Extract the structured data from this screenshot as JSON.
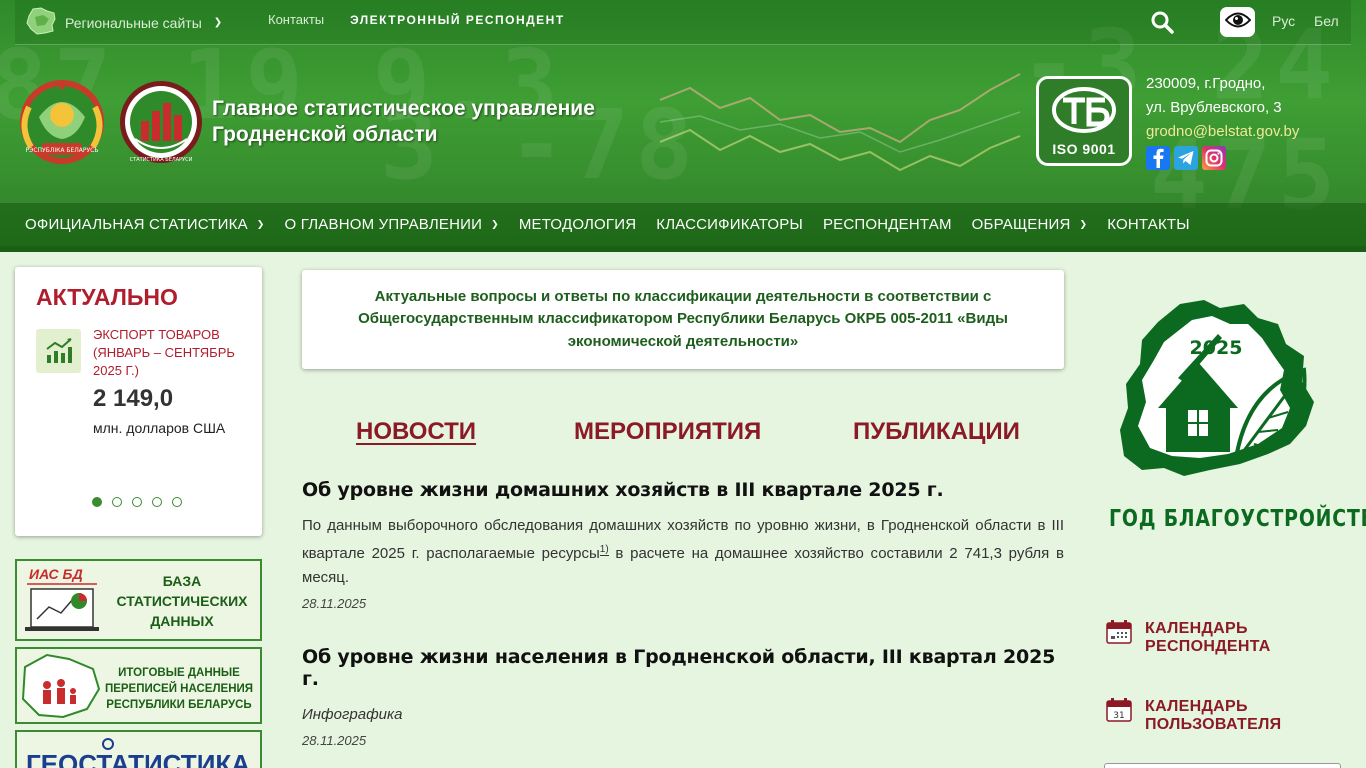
{
  "topbar": {
    "regional_label": "Региональные сайты",
    "contacts_link": "Контакты",
    "e_respondent_link": "ЭЛЕКТРОННЫЙ РЕСПОНДЕНТ",
    "lang_ru": "Рус",
    "lang_be": "Бел"
  },
  "header": {
    "title_line1": "Главное статистическое управление",
    "title_line2": "Гродненской области",
    "iso_label": "ISO 9001",
    "address_line1": "230009, г.Гродно,",
    "address_line2": "ул. Врублевского, 3",
    "email": "grodno@belstat.gov.by",
    "emblem_text_1": "РЭСПУБЛІКА БЕЛАРУСЬ",
    "emblem_text_2": "СТАТИСТИКА БЕЛАРУСИ"
  },
  "nav": {
    "items": [
      {
        "label": "ОФИЦИАЛЬНАЯ СТАТИСТИКА",
        "dropdown": true
      },
      {
        "label": "О ГЛАВНОМ УПРАВЛЕНИИ",
        "dropdown": true
      },
      {
        "label": "МЕТОДОЛОГИЯ",
        "dropdown": false
      },
      {
        "label": "КЛАССИФИКАТОРЫ",
        "dropdown": false
      },
      {
        "label": "РЕСПОНДЕНТАМ",
        "dropdown": false
      },
      {
        "label": "ОБРАЩЕНИЯ",
        "dropdown": true
      },
      {
        "label": "КОНТАКТЫ",
        "dropdown": false
      }
    ]
  },
  "aktual": {
    "heading": "АКТУАЛЬНО",
    "label": "ЭКСПОРТ ТОВАРОВ (ЯНВАРЬ – СЕНТЯБРЬ 2025 Г.)",
    "value": "2 149,0",
    "unit": "млн. долларов США",
    "slides": 5,
    "active_slide": 1
  },
  "banners": {
    "b1_tag": "ИАС БД",
    "b1_line1": "БАЗА",
    "b1_line2": "СТАТИСТИЧЕСКИХ",
    "b1_line3": "ДАННЫХ",
    "b2_line1": "ИТОГОВЫЕ ДАННЫЕ",
    "b2_line2": "ПЕРЕПИСЕЙ НАСЕЛЕНИЯ",
    "b2_line3": "РЕСПУБЛИКИ БЕЛАРУСЬ",
    "b3_text": "ГЕОСТАТИСТИКА"
  },
  "notice": {
    "text": "Актуальные вопросы и ответы по классификации деятельности в соответствии с Общегосударственным классификатором Республики Беларусь ОКРБ 005-2011 «Виды экономической деятельности»"
  },
  "tabs": {
    "news": "НОВОСТИ",
    "events": "МЕРОПРИЯТИЯ",
    "publications": "ПУБЛИКАЦИИ"
  },
  "news": [
    {
      "title": "Об уровне жизни домашних хозяйств в III квартале 2025 г.",
      "desc_before": "По данным выборочного обследования домашних хозяйств по уровню жизни, в Гродненской области в III квартале 2025 г. располагаемые ресурсы",
      "footnote": "1)",
      "desc_after": " в расчете на домашнее хозяйство составили 2 741,3 рубля в месяц.",
      "date": "28.11.2025"
    },
    {
      "title": "Об уровне жизни населения в Гродненской области, III квартал 2025 г.",
      "desc": "Инфографика",
      "date": "28.11.2025"
    }
  ],
  "right": {
    "year_number": "2025",
    "year_title": "ГОД БЛАГОУСТРОЙСТВА",
    "cal_resp_line1": "КАЛЕНДАРЬ",
    "cal_resp_line2": "РЕСПОНДЕНТА",
    "cal_user_line1": "КАЛЕНДАРЬ",
    "cal_user_line2": "ПОЛЬЗОВАТЕЛЯ",
    "cal_user_day": "31"
  },
  "colors": {
    "header_green": "#3f9e34",
    "accent_red": "#8b1a26",
    "page_bg": "#e6f5df",
    "emblem_green": "#0c6a20"
  },
  "icons": {
    "regional": "belarus-map-icon",
    "search": "search-icon",
    "accessibility": "eye-icon",
    "aktual": "growth-chart-icon",
    "calendar": "calendar-icon",
    "facebook": "facebook-icon",
    "telegram": "telegram-icon",
    "instagram": "instagram-icon"
  }
}
